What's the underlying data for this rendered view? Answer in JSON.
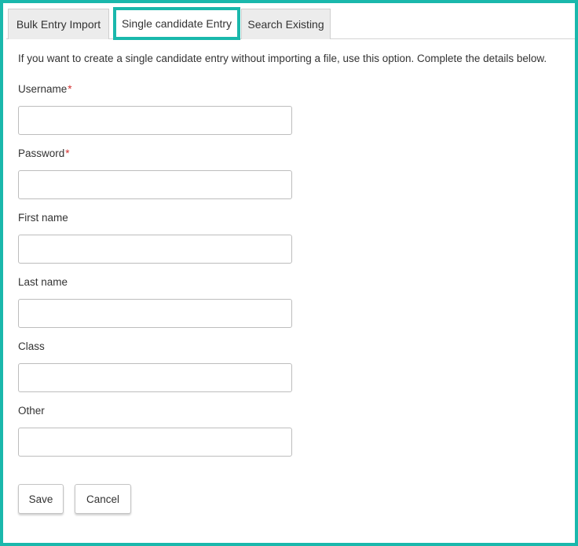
{
  "tabs": {
    "bulk_label": "Bulk Entry Import",
    "single_label": "Single candidate Entry",
    "search_label": "Search Existing",
    "active": "Single candidate Entry"
  },
  "intro_text": "If you want to create a single candidate entry without importing a file, use this option. Complete the details below.",
  "required_marker": "*",
  "fields": {
    "username": {
      "label": "Username",
      "value": ""
    },
    "password": {
      "label": "Password",
      "value": ""
    },
    "first_name": {
      "label": "First name",
      "value": ""
    },
    "last_name": {
      "label": "Last name",
      "value": ""
    },
    "class": {
      "label": "Class",
      "value": ""
    },
    "other": {
      "label": "Other",
      "value": ""
    }
  },
  "buttons": {
    "save_label": "Save",
    "cancel_label": "Cancel"
  },
  "colors": {
    "accent": "#1ab8ac",
    "required": "#d32f2f"
  }
}
